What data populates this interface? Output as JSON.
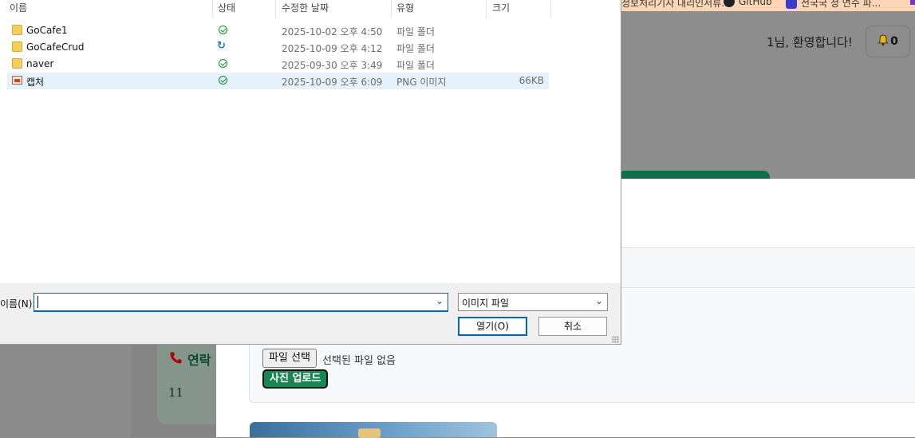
{
  "browser": {
    "bookmarks": [
      {
        "label": "정보처리기사 대리인서류...",
        "icon": "page-icon"
      },
      {
        "label": "GitHub",
        "icon": "github-icon"
      },
      {
        "label": "전국국 정 연수 파...",
        "icon": "app-icon"
      }
    ]
  },
  "page": {
    "welcome": "1님, 환영합니다!",
    "notification_count": "0",
    "file_button_label": "파일 선택",
    "file_none_label": "선택된 파일 없음",
    "upload_button_label": "사진 업로드",
    "contact_title": "연락",
    "contact_value": "11"
  },
  "dialog": {
    "columns": {
      "name": "이름",
      "status": "상태",
      "modified": "수정한 날짜",
      "type": "유형",
      "size": "크기"
    },
    "files": [
      {
        "name": "GoCafe1",
        "kind": "folder",
        "status": "synced",
        "modified": "2025-10-02 오후 4:50",
        "type": "파일 폴더",
        "size": ""
      },
      {
        "name": "GoCafeCrud",
        "kind": "folder",
        "status": "syncing",
        "modified": "2025-10-09 오후 4:12",
        "type": "파일 폴더",
        "size": ""
      },
      {
        "name": "naver",
        "kind": "folder",
        "status": "synced",
        "modified": "2025-09-30 오후 3:49",
        "type": "파일 폴더",
        "size": ""
      },
      {
        "name": "캡처",
        "kind": "image",
        "status": "synced",
        "modified": "2025-10-09 오후 6:09",
        "type": "PNG 이미지",
        "size": "66KB",
        "selected": true
      }
    ],
    "filename_label": "이름(N):",
    "filename_value": "",
    "filetype_value": "이미지 파일",
    "open_label": "열기(O)",
    "cancel_label": "취소"
  },
  "colors": {
    "accent": "#0067c0",
    "selected_row": "#e5f1fb",
    "upload_green": "#198754",
    "sync_ok": "#188a37"
  }
}
